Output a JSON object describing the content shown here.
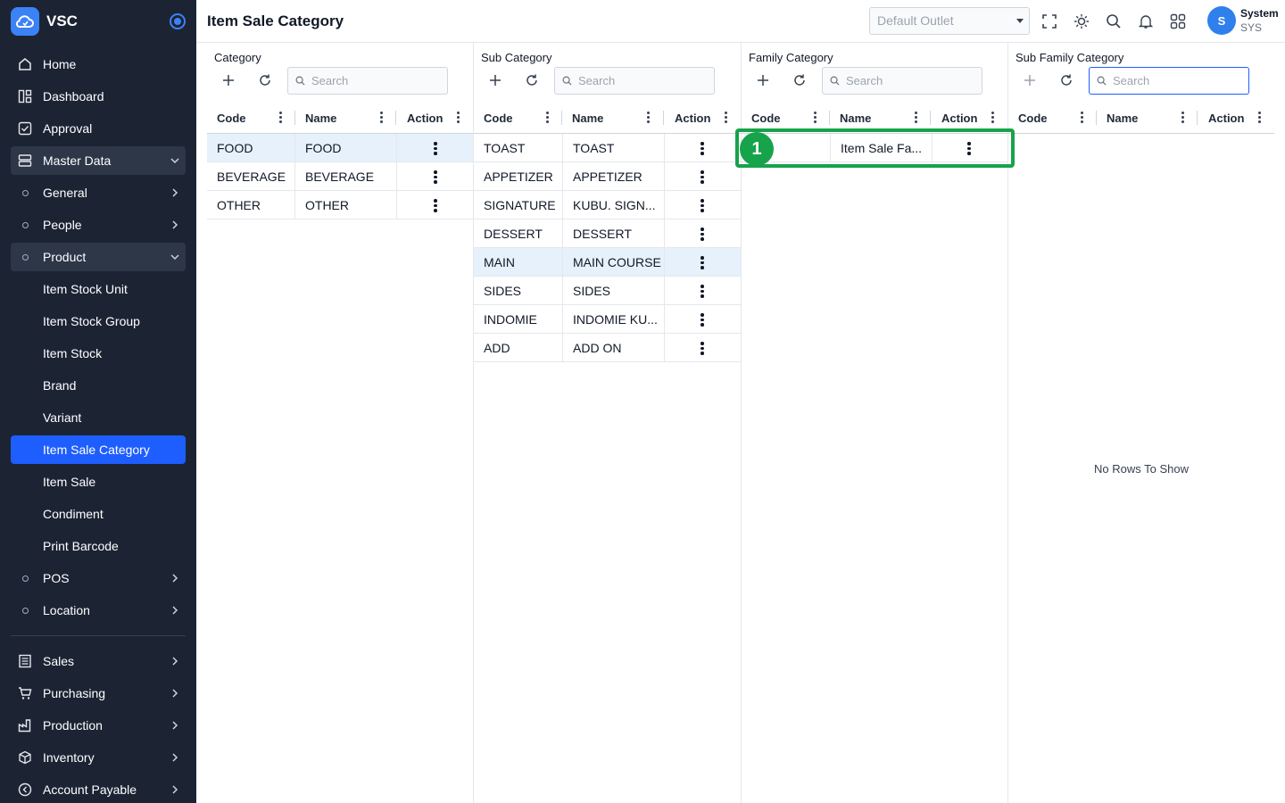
{
  "app": {
    "name": "VSC"
  },
  "sidebar": {
    "items": [
      {
        "label": "Home",
        "icon": "home-icon"
      },
      {
        "label": "Dashboard",
        "icon": "dashboard-icon"
      },
      {
        "label": "Approval",
        "icon": "approval-icon"
      },
      {
        "label": "Master Data",
        "icon": "database-icon"
      },
      {
        "label": "General"
      },
      {
        "label": "People"
      },
      {
        "label": "Product"
      },
      {
        "label": "Item Stock Unit"
      },
      {
        "label": "Item Stock Group"
      },
      {
        "label": "Item Stock"
      },
      {
        "label": "Brand"
      },
      {
        "label": "Variant"
      },
      {
        "label": "Item Sale Category"
      },
      {
        "label": "Item Sale"
      },
      {
        "label": "Condiment"
      },
      {
        "label": "Print Barcode"
      },
      {
        "label": "POS"
      },
      {
        "label": "Location"
      },
      {
        "label": "Sales",
        "icon": "sales-icon"
      },
      {
        "label": "Purchasing",
        "icon": "cart-icon"
      },
      {
        "label": "Production",
        "icon": "factory-icon"
      },
      {
        "label": "Inventory",
        "icon": "box-icon"
      },
      {
        "label": "Account Payable",
        "icon": "payable-icon"
      }
    ]
  },
  "header": {
    "title": "Item Sale Category",
    "outlet_placeholder": "Default Outlet",
    "user": {
      "name": "System",
      "code": "SYS",
      "initial": "S"
    }
  },
  "panels": [
    {
      "title": "Category",
      "search_placeholder": "Search",
      "columns": [
        "Code",
        "Name",
        "Action"
      ],
      "rows": [
        {
          "code": "FOOD",
          "name": "FOOD"
        },
        {
          "code": "BEVERAGE",
          "name": "BEVERAGE"
        },
        {
          "code": "OTHER",
          "name": "OTHER"
        }
      ]
    },
    {
      "title": "Sub Category",
      "search_placeholder": "Search",
      "columns": [
        "Code",
        "Name",
        "Action"
      ],
      "rows": [
        {
          "code": "TOAST",
          "name": "TOAST"
        },
        {
          "code": "APPETIZER",
          "name": "APPETIZER"
        },
        {
          "code": "SIGNATURE",
          "name": "KUBU. SIGN..."
        },
        {
          "code": "DESSERT",
          "name": "DESSERT"
        },
        {
          "code": "MAIN",
          "name": "MAIN COURSE"
        },
        {
          "code": "SIDES",
          "name": "SIDES"
        },
        {
          "code": "INDOMIE",
          "name": "INDOMIE KU..."
        },
        {
          "code": "ADD",
          "name": "ADD ON"
        }
      ]
    },
    {
      "title": "Family Category",
      "search_placeholder": "Search",
      "columns": [
        "Code",
        "Name",
        "Action"
      ],
      "rows": [
        {
          "code": "",
          "name": "Item Sale Fa..."
        }
      ]
    },
    {
      "title": "Sub Family Category",
      "search_placeholder": "Search",
      "columns": [
        "Code",
        "Name",
        "Action"
      ],
      "rows": [],
      "empty_text": "No Rows To Show"
    }
  ],
  "annotation": {
    "label": "1",
    "color": "#16a34a"
  },
  "colors": {
    "sidebar_bg": "#1c2434",
    "accent": "#1e5eff",
    "row_highlight": "#e6f1fc"
  }
}
